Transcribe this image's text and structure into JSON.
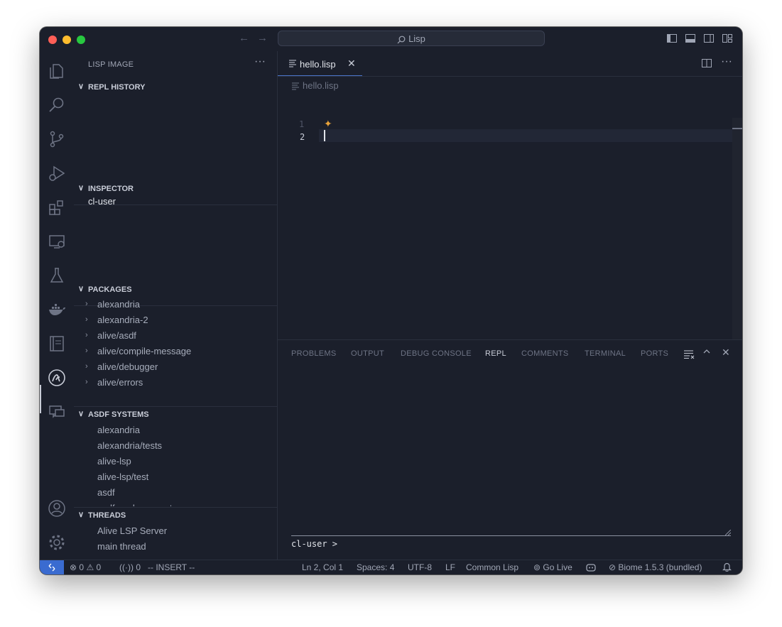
{
  "window": {
    "traffic_lights": [
      "#ff5f57",
      "#febc2e",
      "#28c840"
    ],
    "search_label": "Lisp"
  },
  "sidebar": {
    "title": "LISP IMAGE",
    "more": "···",
    "repl_history": {
      "label": "REPL HISTORY"
    },
    "inspector": {
      "label": "INSPECTOR",
      "items": [
        "cl-user"
      ]
    },
    "packages": {
      "label": "PACKAGES",
      "items": [
        "alexandria",
        "alexandria-2",
        "alive/asdf",
        "alive/compile-message",
        "alive/debugger",
        "alive/errors"
      ]
    },
    "asdf_systems": {
      "label": "ASDF SYSTEMS",
      "items": [
        "alexandria",
        "alexandria/tests",
        "alive-lsp",
        "alive-lsp/test",
        "asdf",
        "asdf-package-system"
      ]
    },
    "threads": {
      "label": "THREADS",
      "items": [
        "Alive LSP Server",
        "main thread"
      ]
    }
  },
  "editor": {
    "tab_label": "hello.lisp",
    "breadcrumb": "hello.lisp",
    "line_numbers": [
      "1",
      "2"
    ],
    "sparkle": "✦"
  },
  "panel": {
    "tabs": [
      "PROBLEMS",
      "OUTPUT",
      "DEBUG CONSOLE",
      "REPL",
      "COMMENTS",
      "TERMINAL",
      "PORTS"
    ],
    "active_tab": "REPL",
    "prompt": "cl-user >"
  },
  "status": {
    "errors": "0",
    "warnings": "0",
    "ports": "0",
    "mode": "-- INSERT --",
    "position": "Ln 2, Col 1",
    "spaces": "Spaces: 4",
    "encoding": "UTF-8",
    "eol": "LF",
    "language": "Common Lisp",
    "go_live": "Go Live",
    "biome": "Biome 1.5.3 (bundled)"
  },
  "colors": {
    "accent": "#3a6bd0",
    "background": "#1b1f2b",
    "sparkle": "#e8a33a"
  }
}
